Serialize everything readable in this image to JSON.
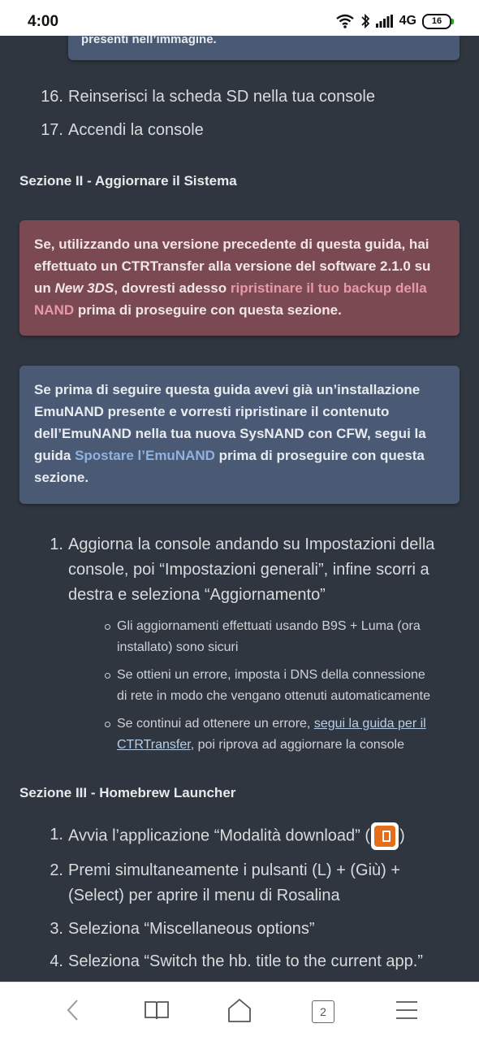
{
  "status": {
    "time": "4:00",
    "network": "4G",
    "battery": "16"
  },
  "top_note": {
    "text": "presenti nell’immagine."
  },
  "steps_end": [
    {
      "num": "16.",
      "text": "Reinserisci la scheda SD nella tua console"
    },
    {
      "num": "17.",
      "text": "Accendi la console"
    }
  ],
  "section2": {
    "title": "Sezione II - Aggiornare il Sistema",
    "red_note": {
      "pre": "Se, utilizzando una versione precedente di questa guida, hai effettuato un CTRTransfer alla versione del software 2.1.0 su un ",
      "em": "New 3DS",
      "mid": ", dovresti adesso ",
      "link": "ripristinare il tuo backup della NAND",
      "post": " prima di proseguire con questa sezione."
    },
    "blue_note": {
      "pre": "Se prima di seguire questa guida avevi già un’installazione EmuNAND presente e vorresti ripristinare il contenuto dell’EmuNAND nella tua nuova SysNAND con CFW, segui la guida ",
      "link": "Spostare l’EmuNAND",
      "post": " prima di proseguire con questa sezione."
    },
    "step1": {
      "num": "1.",
      "lines": [
        "Aggiorna la console andando su Impostazioni della",
        "console, poi “Impostazioni generali”, infine scorri a",
        "destra e seleziona “Aggiornamento”"
      ]
    },
    "subitems": [
      {
        "lines": [
          "Gli aggiornamenti effettuati usando B9S + Luma (ora",
          "installato) sono sicuri"
        ]
      },
      {
        "lines": [
          "Se ottieni un errore, imposta i DNS della connessione",
          "di rete in modo che vengano ottenuti automaticamente"
        ]
      },
      {
        "pre": "Se continui ad ottenere un errore, ",
        "link1": "segui la guida per il",
        "link2": "CTRTransfer",
        "post": ", poi riprova ad aggiornare la console"
      }
    ]
  },
  "section3": {
    "title": "Sezione III - Homebrew Launcher",
    "steps": [
      {
        "num": "1.",
        "lines": [
          "Avvia l’applicazione “Modalità download” ("
        ],
        "suffix": ")"
      },
      {
        "num": "2.",
        "lines": [
          "Premi simultaneamente i pulsanti (L) + (Giù) +",
          "(Select) per aprire il menu di Rosalina"
        ]
      },
      {
        "num": "3.",
        "lines": [
          "Seleziona “Miscellaneous options”"
        ]
      },
      {
        "num": "4.",
        "lines": [
          "Seleziona “Switch the hb. title to the current app.”"
        ]
      }
    ]
  },
  "navbar": {
    "tab_count": "2"
  },
  "icons": {
    "back": "back-arrow-icon",
    "bookmarks": "book-icon",
    "home": "home-icon",
    "tabs": "tabs-icon",
    "menu": "menu-icon",
    "download_play": "download-play-app-icon"
  }
}
